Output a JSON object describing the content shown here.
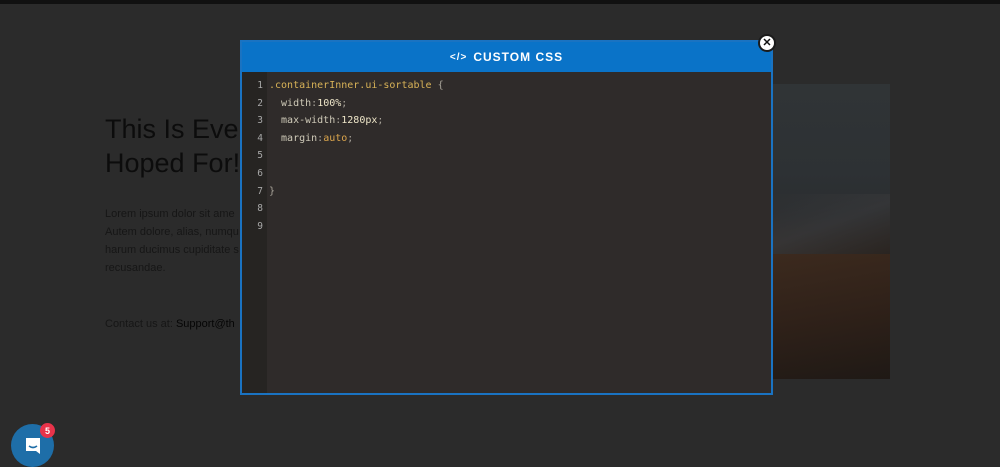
{
  "background_page": {
    "heading_lines": [
      "This Is Eve",
      "Hoped For!"
    ],
    "paragraph_lines": [
      "Lorem ipsum dolor sit ame",
      "Autem dolore, alias, numqu",
      "harum ducimus cupiditate s",
      "recusandae."
    ],
    "contact_label": "Contact us at: ",
    "contact_email": "Support@th"
  },
  "modal": {
    "title": "CUSTOM CSS",
    "title_icon": "code-icon",
    "close_icon": "close-icon",
    "code_lines": [
      {
        "n": "1",
        "tokens": [
          {
            "t": ".containerInner.ui-sortable",
            "c": "sel"
          },
          {
            "t": " {",
            "c": "punct"
          }
        ]
      },
      {
        "n": "2",
        "tokens": [
          {
            "t": "  width",
            "c": "prop"
          },
          {
            "t": ":",
            "c": "punct"
          },
          {
            "t": "100%",
            "c": "num"
          },
          {
            "t": ";",
            "c": "punct"
          }
        ]
      },
      {
        "n": "3",
        "tokens": [
          {
            "t": "  max-width",
            "c": "prop"
          },
          {
            "t": ":",
            "c": "punct"
          },
          {
            "t": "1280px",
            "c": "num"
          },
          {
            "t": ";",
            "c": "punct"
          }
        ]
      },
      {
        "n": "4",
        "tokens": [
          {
            "t": "  margin",
            "c": "prop"
          },
          {
            "t": ":",
            "c": "punct"
          },
          {
            "t": "auto",
            "c": "kw"
          },
          {
            "t": ";",
            "c": "punct"
          }
        ]
      },
      {
        "n": "5",
        "tokens": []
      },
      {
        "n": "6",
        "tokens": []
      },
      {
        "n": "7",
        "tokens": [
          {
            "t": "}",
            "c": "punct"
          }
        ]
      },
      {
        "n": "8",
        "tokens": []
      },
      {
        "n": "9",
        "tokens": []
      }
    ]
  },
  "chat_widget": {
    "icon": "chat-icon",
    "badge_count": "5",
    "colors": {
      "button": "#1e6ea8",
      "badge": "#e8334a"
    }
  },
  "colors": {
    "header": "#0a73c8",
    "editor_bg": "#2f2b2a",
    "overlay": "#2a2a2a"
  }
}
